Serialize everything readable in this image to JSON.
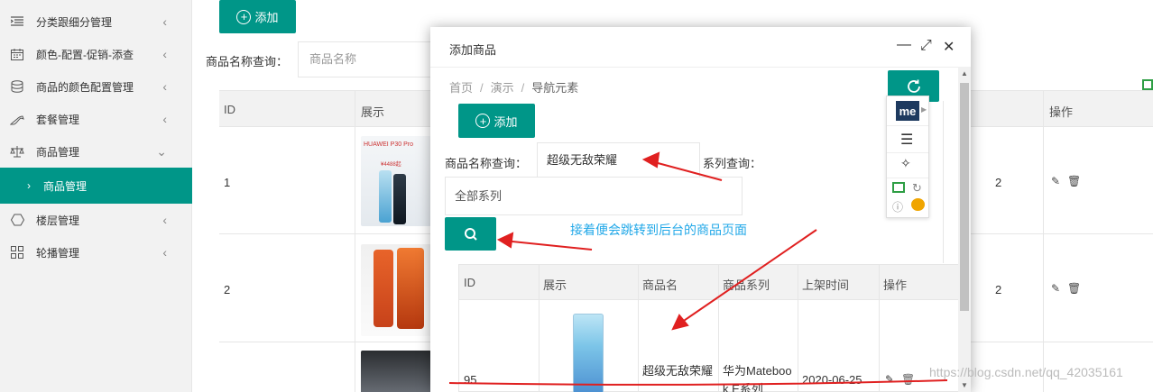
{
  "sidebar": {
    "items": [
      {
        "label": "分类跟细分管理",
        "icon": "list-indent-icon",
        "chevron": "‹"
      },
      {
        "label": "颜色-配置-促销-添查",
        "icon": "calendar-icon",
        "chevron": "‹"
      },
      {
        "label": "商品的颜色配置管理",
        "icon": "database-icon",
        "chevron": "‹"
      },
      {
        "label": "套餐管理",
        "icon": "shoe-icon",
        "chevron": "‹"
      },
      {
        "label": "商品管理",
        "icon": "scale-icon",
        "chevron": "⌄"
      }
    ],
    "active_sub": {
      "label": "商品管理",
      "arrow": "›"
    },
    "items_after": [
      {
        "label": "楼层管理",
        "icon": "hexagon-icon",
        "chevron": "‹"
      },
      {
        "label": "轮播管理",
        "icon": "grid-icon",
        "chevron": "‹"
      }
    ]
  },
  "background_page": {
    "add_button": "添加",
    "search_label": "商品名称查询：",
    "search_placeholder": "商品名称",
    "columns": [
      "ID",
      "展示",
      "操作"
    ],
    "rows": [
      {
        "id": "1"
      },
      {
        "id": "2"
      },
      {
        "id": ""
      }
    ],
    "product1_caption": "HUAWEI P30 Pro",
    "product1_price": "¥4488起",
    "hidden_col_fragment": "2"
  },
  "modal": {
    "title": "添加商品",
    "controls": {
      "minimize": "—",
      "maximize": "⤢",
      "close": "✕"
    },
    "breadcrumb": [
      "首页",
      "演示",
      "导航元素"
    ],
    "breadcrumb_sep": "/",
    "add_button": "添加",
    "name_query_label": "商品名称查询：",
    "name_query_value": "超级无敌荣耀",
    "series_query_label": "系列查询：",
    "series_select_value": "全部系列",
    "annotation": "接着便会跳转到后台的商品页面",
    "table": {
      "columns": [
        "ID",
        "展示",
        "商品名",
        "商品系列",
        "上架时间",
        "操作"
      ],
      "rows": [
        {
          "id": "95",
          "name": "超级无敌荣耀",
          "series": "华为Matebook E系列",
          "date": "2020-06-25"
        }
      ]
    }
  },
  "extension": {
    "badge": "me"
  },
  "watermark": "https://blog.csdn.net/qq_42035161",
  "colors": {
    "primary": "#009688",
    "annotation": "#22a8e8",
    "arrow": "#e02020"
  }
}
